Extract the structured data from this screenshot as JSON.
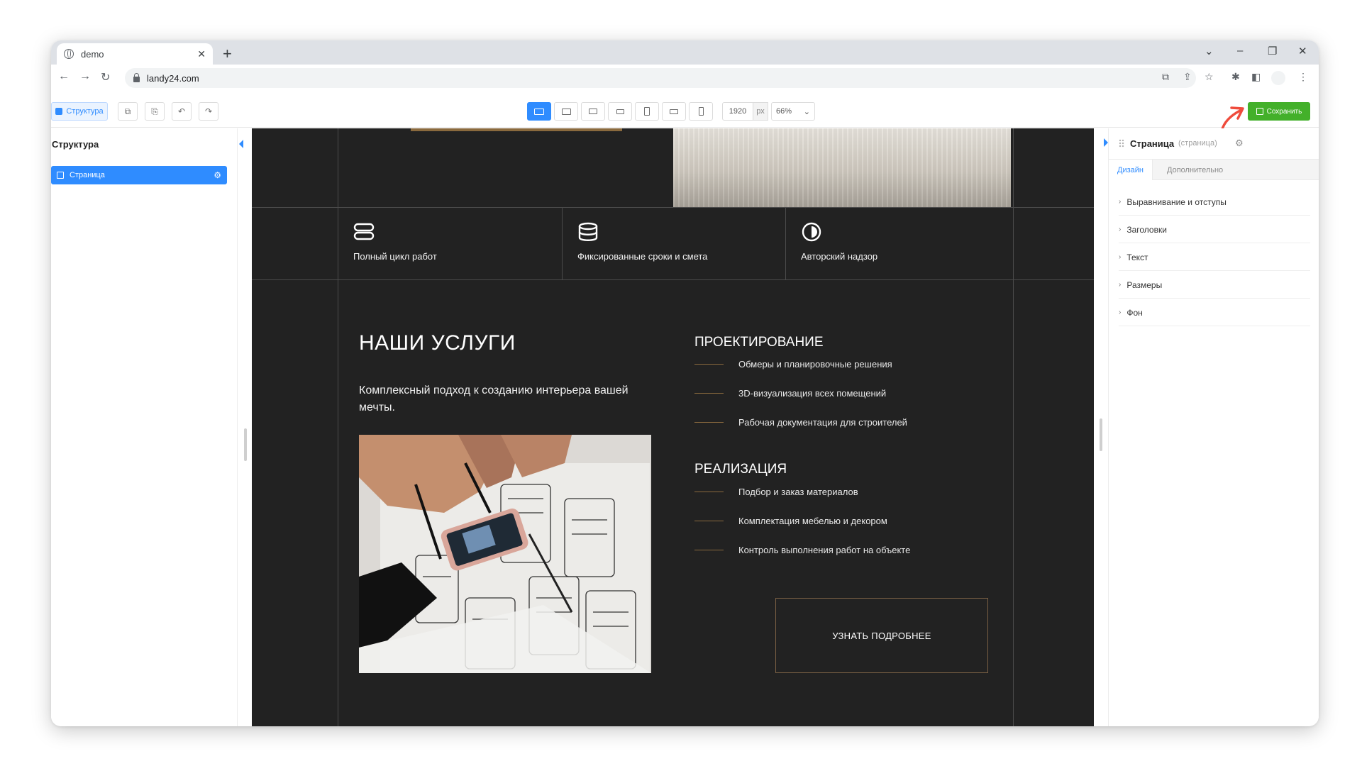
{
  "browser": {
    "tab_title": "demo",
    "tab_close": "✕",
    "new_tab": "+",
    "url": "landy24.com",
    "nav_back": "←",
    "nav_forward": "→",
    "nav_reload": "↻",
    "win_tabsearch": "⌄",
    "win_minimize": "–",
    "win_restore": "❐",
    "win_close": "✕",
    "icon_translate": "⧉",
    "icon_share": "⇪",
    "icon_star": "☆",
    "icon_extensions": "✱",
    "icon_sidepanel": "◧",
    "icon_menu": "⋮"
  },
  "toolbar": {
    "structure_label": "Структура",
    "copy_icon": "⧉",
    "paste_icon": "⎘",
    "undo_icon": "↶",
    "redo_icon": "↷",
    "width_value": "1920",
    "width_unit": "px",
    "zoom_value": "66%",
    "zoom_chevron": "⌄",
    "save_label": "Сохранить",
    "accent_color": "#2f8cff",
    "save_color": "#43b02a",
    "annotation_color": "#ef4b3c"
  },
  "left_panel": {
    "title": "Структура",
    "items": [
      {
        "label": "Страница",
        "gear": "⚙"
      }
    ]
  },
  "canvas": {
    "features": [
      {
        "icon": "database-stack-icon",
        "label": "Полный цикл работ"
      },
      {
        "icon": "cylinder-icon",
        "label": "Фиксированные сроки и смета"
      },
      {
        "icon": "half-circle-icon",
        "label": "Авторский надзор"
      }
    ],
    "services_title": "НАШИ УСЛУГИ",
    "services_lead": "Комплексный подход к созданию интерьера вашей мечты.",
    "design_title": "ПРОЕКТИРОВАНИЕ",
    "design_items": [
      "Обмеры и планировочные решения",
      "3D-визуализация всех помещений",
      "Рабочая документация для строителей"
    ],
    "impl_title": "РЕАЛИЗАЦИЯ",
    "impl_items": [
      "Подбор и заказ материалов",
      "Комплектация мебелью и декором",
      "Контроль выполнения работ на объекте"
    ],
    "cta_label": "УЗНАТЬ ПОДРОБНЕЕ",
    "bg_color": "#222222",
    "accent_color": "#8a6a3e"
  },
  "right_panel": {
    "title": "Страница",
    "subtitle": "(страница)",
    "gear": "⚙",
    "tabs": [
      "Дизайн",
      "Дополнительно"
    ],
    "sections": [
      "Выравнивание и отступы",
      "Заголовки",
      "Текст",
      "Размеры",
      "Фон"
    ],
    "chevron": "›"
  }
}
